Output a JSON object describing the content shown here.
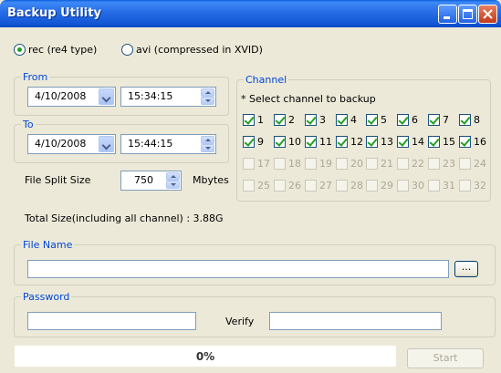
{
  "window": {
    "title": "Backup  Utility"
  },
  "format": {
    "options": [
      {
        "label": "rec (re4 type)",
        "selected": true
      },
      {
        "label": "avi (compressed in XVID)",
        "selected": false
      }
    ]
  },
  "from": {
    "legend": "From",
    "date": "4/10/2008",
    "time": "15:34:15"
  },
  "to": {
    "legend": "To",
    "date": "4/10/2008",
    "time": "15:44:15"
  },
  "split": {
    "label": "File Split Size",
    "value": "750",
    "unit": "Mbytes"
  },
  "total_size": "Total Size(including all channel) : 3.88G",
  "channel": {
    "legend": "Channel",
    "hint": "* Select channel to backup",
    "items": [
      {
        "n": "1",
        "checked": true
      },
      {
        "n": "2",
        "checked": true
      },
      {
        "n": "3",
        "checked": true
      },
      {
        "n": "4",
        "checked": true
      },
      {
        "n": "5",
        "checked": true
      },
      {
        "n": "6",
        "checked": true
      },
      {
        "n": "7",
        "checked": true
      },
      {
        "n": "8",
        "checked": true
      },
      {
        "n": "9",
        "checked": true
      },
      {
        "n": "10",
        "checked": true
      },
      {
        "n": "11",
        "checked": true
      },
      {
        "n": "12",
        "checked": true
      },
      {
        "n": "13",
        "checked": true
      },
      {
        "n": "14",
        "checked": true
      },
      {
        "n": "15",
        "checked": true
      },
      {
        "n": "16",
        "checked": true
      },
      {
        "n": "17",
        "disabled": true
      },
      {
        "n": "18",
        "disabled": true
      },
      {
        "n": "19",
        "disabled": true
      },
      {
        "n": "20",
        "disabled": true
      },
      {
        "n": "21",
        "disabled": true
      },
      {
        "n": "22",
        "disabled": true
      },
      {
        "n": "23",
        "disabled": true
      },
      {
        "n": "24",
        "disabled": true
      },
      {
        "n": "25",
        "disabled": true
      },
      {
        "n": "26",
        "disabled": true
      },
      {
        "n": "27",
        "disabled": true
      },
      {
        "n": "28",
        "disabled": true
      },
      {
        "n": "29",
        "disabled": true
      },
      {
        "n": "30",
        "disabled": true
      },
      {
        "n": "31",
        "disabled": true
      },
      {
        "n": "32",
        "disabled": true
      }
    ]
  },
  "file": {
    "legend": "File Name",
    "value": "",
    "browse_label": "..."
  },
  "password": {
    "legend": "Password",
    "value": "",
    "verify_label": "Verify",
    "verify_value": ""
  },
  "progress": {
    "text": "0%",
    "value": 0
  },
  "start_label": "Start",
  "colors": {
    "titlebar": "#0a5fdc",
    "legend_text": "#0046d5",
    "check": "#21a121",
    "face": "#ece9d8"
  }
}
